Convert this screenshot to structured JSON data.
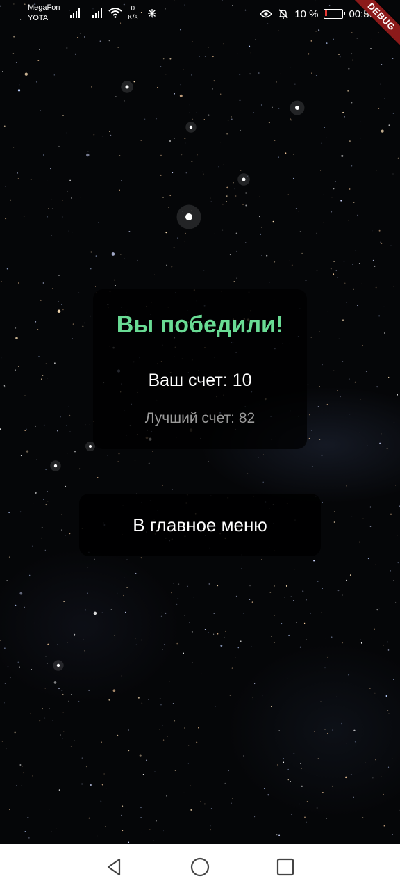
{
  "status_bar": {
    "carrier_1": "MegaFon",
    "carrier_2": "YOTA",
    "net_speed_value": "0",
    "net_speed_unit": "K/s",
    "battery": "10 %",
    "time": "00:50",
    "icons": [
      "signal-icon",
      "signal-icon",
      "wifi-icon",
      "activity-icon",
      "eye-icon",
      "bell-off-icon",
      "battery-icon"
    ]
  },
  "debug_banner": "DEBUG",
  "result": {
    "title": "Вы победили!",
    "score": "Ваш счет: 10",
    "best": "Лучший счет: 82"
  },
  "menu_button": "В главное меню",
  "colors": {
    "title": "#69db94",
    "background": "#050608",
    "debug_banner": "#8b1a1a",
    "battery_low": "#e53935"
  },
  "nav_bar": {
    "icons": [
      "back-icon",
      "home-icon",
      "recent-apps-icon"
    ]
  }
}
